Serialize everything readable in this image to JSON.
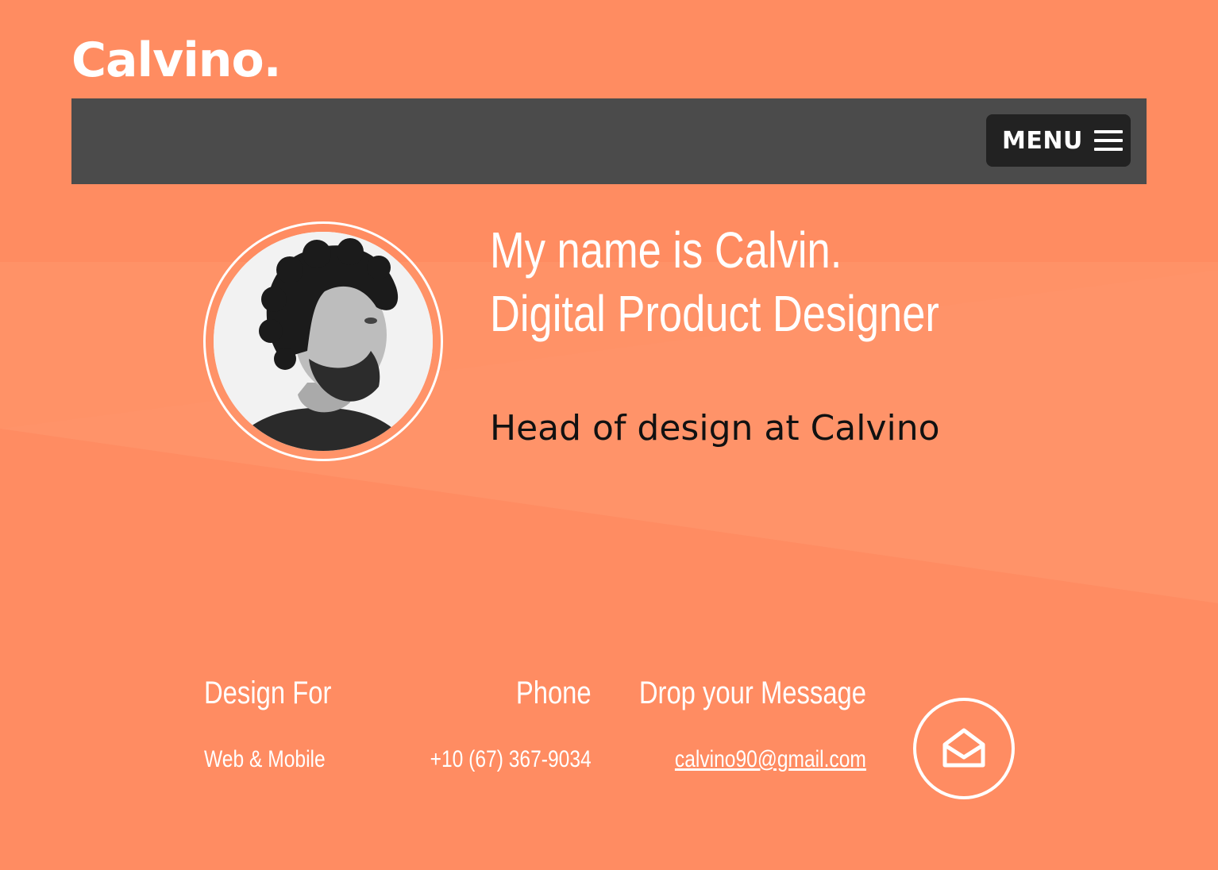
{
  "header": {
    "logo_text": "Calvino.",
    "menu_label": "MENU",
    "menu_icon": "hamburger-icon"
  },
  "hero": {
    "avatar_icon": "profile-photo",
    "title_line1": "My name is Calvin.",
    "title_line2": "Digital Product Designer",
    "subtitle": "Head of design at Calvino"
  },
  "info": {
    "design_for_heading": "Design For",
    "design_for_value": "Web & Mobile",
    "phone_heading": "Phone",
    "phone_value": "+10 (67) 367-9034",
    "message_heading": "Drop your Message",
    "email": "calvino90@gmail.com",
    "mail_icon": "open-envelope-icon"
  },
  "colors": {
    "background": "#ff8c62",
    "navbar": "#4b4b4b",
    "menu_button": "#222222",
    "text_light": "#ffffff",
    "text_dark": "#111111"
  }
}
